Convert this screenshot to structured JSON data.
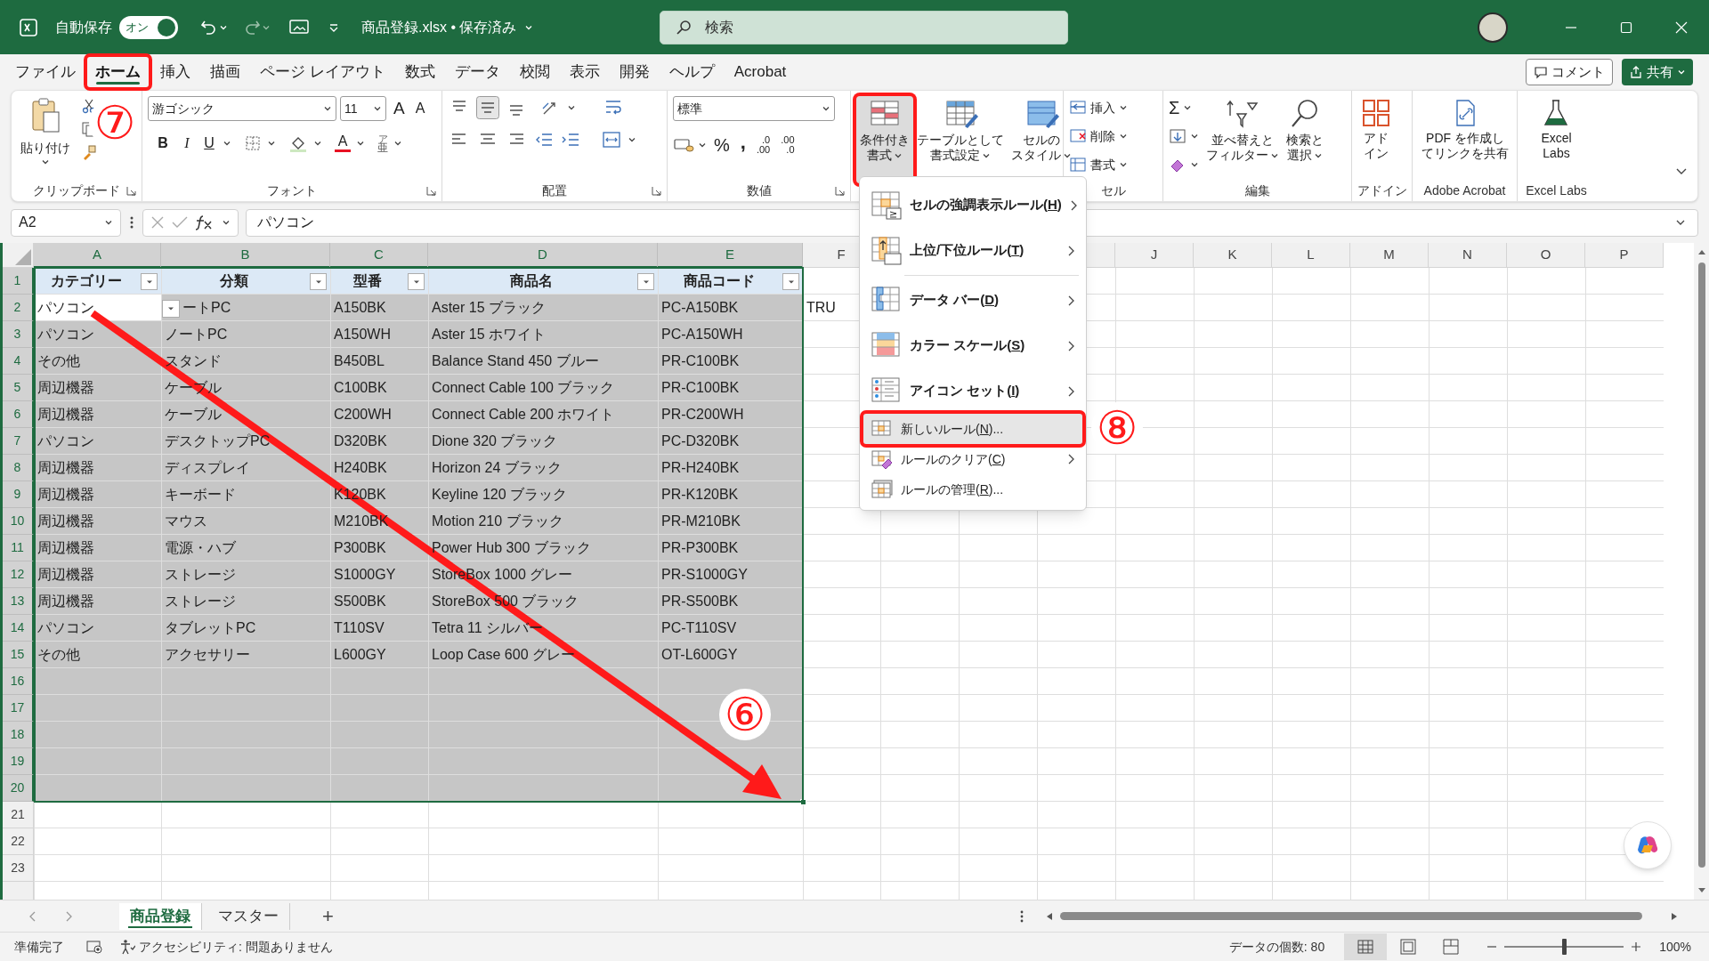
{
  "title_bar": {
    "autosave_label": "自動保存",
    "autosave_on": true,
    "toggle_text": "オン",
    "file_title": "商品登録.xlsx • 保存済み",
    "search_placeholder": "検索"
  },
  "menu_tabs": [
    {
      "label": "ファイル",
      "selected": false,
      "annotated": false
    },
    {
      "label": "ホーム",
      "selected": true,
      "annotated": true
    },
    {
      "label": "挿入",
      "selected": false,
      "annotated": false
    },
    {
      "label": "描画",
      "selected": false,
      "annotated": false
    },
    {
      "label": "ページ レイアウト",
      "selected": false,
      "annotated": false
    },
    {
      "label": "数式",
      "selected": false,
      "annotated": false
    },
    {
      "label": "データ",
      "selected": false,
      "annotated": false
    },
    {
      "label": "校閲",
      "selected": false,
      "annotated": false
    },
    {
      "label": "表示",
      "selected": false,
      "annotated": false
    },
    {
      "label": "開発",
      "selected": false,
      "annotated": false
    },
    {
      "label": "ヘルプ",
      "selected": false,
      "annotated": false
    },
    {
      "label": "Acrobat",
      "selected": false,
      "annotated": false
    }
  ],
  "comment_button": "コメント",
  "share_button": "共有",
  "ribbon": {
    "clipboard": {
      "label": "クリップボード",
      "paste": "貼り付け"
    },
    "font": {
      "label": "フォント",
      "font_name": "游ゴシック",
      "font_size": "11",
      "grow": "A",
      "shrink": "A",
      "bold": "B",
      "italic": "I",
      "underline": "U",
      "font_color": "A",
      "phonetic_top": "ア",
      "phonetic_bottom": "亜"
    },
    "alignment": {
      "label": "配置"
    },
    "number": {
      "label": "数値",
      "format": "標準",
      "percent": "%",
      "comma": ",",
      "increase_decimal": {
        "top": ".0",
        "bottom": ".00"
      },
      "decrease_decimal": {
        "top": ".00",
        "bottom": ".0"
      }
    },
    "styles": [
      {
        "lines": [
          "条件付き",
          "書式"
        ],
        "pressed": true,
        "annotated": true
      },
      {
        "lines": [
          "テーブルとして",
          "書式設定"
        ],
        "pressed": false,
        "annotated": false
      },
      {
        "lines": [
          "セルの",
          "スタイル"
        ],
        "pressed": false,
        "annotated": false
      }
    ],
    "cells": {
      "label": "セル",
      "buttons": [
        "挿入",
        "削除",
        "書式"
      ]
    },
    "editing": {
      "label": "編集",
      "sum": "Σ",
      "sort": [
        "並べ替えと",
        "フィルター"
      ],
      "find": [
        "検索と",
        "選択"
      ]
    },
    "addins": {
      "label": "アドイン",
      "button": [
        "アド",
        "イン"
      ]
    },
    "acrobat": {
      "label": "Adobe Acrobat",
      "button": [
        "PDF を作成し",
        "てリンクを共有"
      ]
    },
    "labs": {
      "label": "Excel Labs",
      "button": [
        "Excel",
        "Labs"
      ]
    }
  },
  "formula_bar": {
    "name_box": "A2",
    "formula": "パソコン"
  },
  "sheet": {
    "columns": [
      {
        "label": "A",
        "selected": true
      },
      {
        "label": "B",
        "selected": true
      },
      {
        "label": "C",
        "selected": true
      },
      {
        "label": "D",
        "selected": true
      },
      {
        "label": "E",
        "selected": true
      },
      {
        "label": "F",
        "selected": false
      },
      {
        "label": "J",
        "selected": false
      },
      {
        "label": "K",
        "selected": false
      },
      {
        "label": "L",
        "selected": false
      },
      {
        "label": "M",
        "selected": false
      },
      {
        "label": "N",
        "selected": false
      },
      {
        "label": "O",
        "selected": false
      },
      {
        "label": "P",
        "selected": false
      }
    ],
    "rows": [
      {
        "number": "1",
        "kind": "header",
        "selected": true,
        "active": false,
        "cells": [
          "カテゴリー",
          "分類",
          "型番",
          "商品名",
          "商品コード"
        ]
      },
      {
        "number": "2",
        "kind": "data",
        "selected": true,
        "active": true,
        "cells": [
          "パソコン",
          "ートPC",
          "A150BK",
          "Aster 15 ブラック",
          "PC-A150BK",
          "TRU"
        ]
      },
      {
        "number": "3",
        "kind": "data",
        "selected": true,
        "active": false,
        "cells": [
          "パソコン",
          "ノートPC",
          "A150WH",
          "Aster 15 ホワイト",
          "PC-A150WH"
        ]
      },
      {
        "number": "4",
        "kind": "data",
        "selected": true,
        "active": false,
        "cells": [
          "その他",
          "スタンド",
          "B450BL",
          "Balance Stand 450 ブルー",
          "PR-C100BK"
        ]
      },
      {
        "number": "5",
        "kind": "data",
        "selected": true,
        "active": false,
        "cells": [
          "周辺機器",
          "ケーブル",
          "C100BK",
          "Connect Cable 100 ブラック",
          "PR-C100BK"
        ]
      },
      {
        "number": "6",
        "kind": "data",
        "selected": true,
        "active": false,
        "cells": [
          "周辺機器",
          "ケーブル",
          "C200WH",
          "Connect Cable 200 ホワイト",
          "PR-C200WH"
        ]
      },
      {
        "number": "7",
        "kind": "data",
        "selected": true,
        "active": false,
        "cells": [
          "パソコン",
          "デスクトップPC",
          "D320BK",
          "Dione 320 ブラック",
          "PC-D320BK"
        ]
      },
      {
        "number": "8",
        "kind": "data",
        "selected": true,
        "active": false,
        "cells": [
          "周辺機器",
          "ディスプレイ",
          "H240BK",
          "Horizon 24 ブラック",
          "PR-H240BK"
        ]
      },
      {
        "number": "9",
        "kind": "data",
        "selected": true,
        "active": false,
        "cells": [
          "周辺機器",
          "キーボード",
          "K120BK",
          "Keyline 120 ブラック",
          "PR-K120BK"
        ]
      },
      {
        "number": "10",
        "kind": "data",
        "selected": true,
        "active": false,
        "cells": [
          "周辺機器",
          "マウス",
          "M210BK",
          "Motion 210 ブラック",
          "PR-M210BK"
        ]
      },
      {
        "number": "11",
        "kind": "data",
        "selected": true,
        "active": false,
        "cells": [
          "周辺機器",
          "電源・ハブ",
          "P300BK",
          "Power Hub 300 ブラック",
          "PR-P300BK"
        ]
      },
      {
        "number": "12",
        "kind": "data",
        "selected": true,
        "active": false,
        "cells": [
          "周辺機器",
          "ストレージ",
          "S1000GY",
          "StoreBox 1000 グレー",
          "PR-S1000GY"
        ]
      },
      {
        "number": "13",
        "kind": "data",
        "selected": true,
        "active": false,
        "cells": [
          "周辺機器",
          "ストレージ",
          "S500BK",
          "StoreBox 500 ブラック",
          "PR-S500BK"
        ]
      },
      {
        "number": "14",
        "kind": "data",
        "selected": true,
        "active": false,
        "cells": [
          "パソコン",
          "タブレットPC",
          "T110SV",
          "Tetra 11 シルバー",
          "PC-T110SV"
        ]
      },
      {
        "number": "15",
        "kind": "data",
        "selected": true,
        "active": false,
        "cells": [
          "その他",
          "アクセサリー",
          "L600GY",
          "Loop Case 600 グレー",
          "OT-L600GY"
        ]
      },
      {
        "number": "16",
        "kind": "data",
        "selected": true,
        "active": false
      },
      {
        "number": "17",
        "kind": "data",
        "selected": true,
        "active": false
      },
      {
        "number": "18",
        "kind": "data",
        "selected": true,
        "active": false
      },
      {
        "number": "19",
        "kind": "data",
        "selected": true,
        "active": false
      },
      {
        "number": "20",
        "kind": "data",
        "selected": true,
        "active": false
      },
      {
        "number": "21",
        "kind": "data",
        "selected": false
      },
      {
        "number": "22",
        "kind": "data",
        "selected": false
      },
      {
        "number": "23",
        "kind": "data",
        "selected": false
      }
    ]
  },
  "context_menu": [
    {
      "kind": "large",
      "label": "セルの強調表示ルール(",
      "key": "H",
      "tail": ")",
      "submenu": true,
      "highlighted": false,
      "annotated": false
    },
    {
      "kind": "large",
      "label": "上位/下位ルール(",
      "key": "T",
      "tail": ")",
      "submenu": true,
      "highlighted": false,
      "annotated": false
    },
    {
      "kind": "divider"
    },
    {
      "kind": "large",
      "label": "データ バー(",
      "key": "D",
      "tail": ")",
      "submenu": true,
      "highlighted": false,
      "annotated": false
    },
    {
      "kind": "large",
      "label": "カラー スケール(",
      "key": "S",
      "tail": ")",
      "submenu": true,
      "highlighted": false,
      "annotated": false
    },
    {
      "kind": "large",
      "label": "アイコン セット(",
      "key": "I",
      "tail": ")",
      "submenu": true,
      "highlighted": false,
      "annotated": false
    },
    {
      "kind": "small",
      "label": "新しいルール(",
      "key": "N",
      "tail": ")...",
      "submenu": false,
      "highlighted": true,
      "annotated": true
    },
    {
      "kind": "small",
      "label": "ルールのクリア(",
      "key": "C",
      "tail": ")",
      "submenu": true,
      "highlighted": false,
      "annotated": false
    },
    {
      "kind": "small",
      "label": "ルールの管理(",
      "key": "R",
      "tail": ")...",
      "submenu": false,
      "highlighted": false,
      "annotated": false
    }
  ],
  "step_marks": [
    {
      "label": "⑦"
    },
    {
      "label": "⑧"
    },
    {
      "label": "⑥"
    }
  ],
  "sheet_tabs": [
    {
      "label": "商品登録",
      "selected": true
    },
    {
      "label": "マスター",
      "selected": false
    }
  ],
  "add_sheet": "+",
  "status_bar": {
    "ready": "準備完了",
    "accessibility": "アクセシビリティ: 問題ありません",
    "count": "データの個数: 80",
    "zoom": "100%",
    "zoom_level": {
      "level": 0.5
    }
  }
}
